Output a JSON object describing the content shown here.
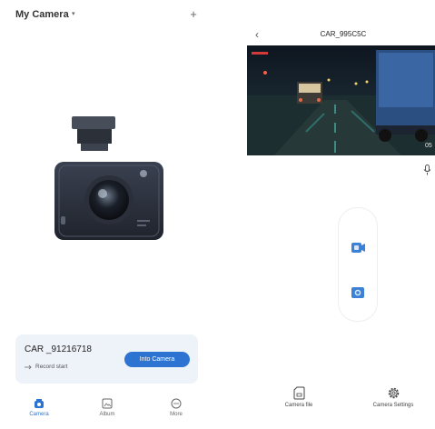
{
  "left_screen": {
    "header": {
      "title": "My Camera",
      "caret": "▾",
      "add_icon": "plus-icon",
      "add_label": "+"
    },
    "device_card": {
      "name": "CAR _91216718",
      "status": "Record start",
      "status_icon": "record-arrow-icon",
      "connect_button": "Into Camera",
      "accent": "#2d74d2"
    },
    "tabbar": {
      "tabs": [
        {
          "label": "Camera",
          "icon": "camera-icon",
          "active": true
        },
        {
          "label": "Album",
          "icon": "album-icon",
          "active": false
        },
        {
          "label": "More",
          "icon": "more-icon",
          "active": false
        }
      ]
    }
  },
  "right_screen": {
    "back_label": "‹",
    "title": "CAR_995C5C",
    "video_preview": {
      "overlay_text": "05"
    },
    "mic_icon": "microphone-icon",
    "capture_buttons": [
      {
        "icon": "video-record-icon"
      },
      {
        "icon": "photo-capture-icon"
      }
    ],
    "actions": [
      {
        "label": "Camera file",
        "icon": "sd-card-icon"
      },
      {
        "label": "Camera Settings",
        "icon": "settings-gear-icon"
      }
    ]
  }
}
